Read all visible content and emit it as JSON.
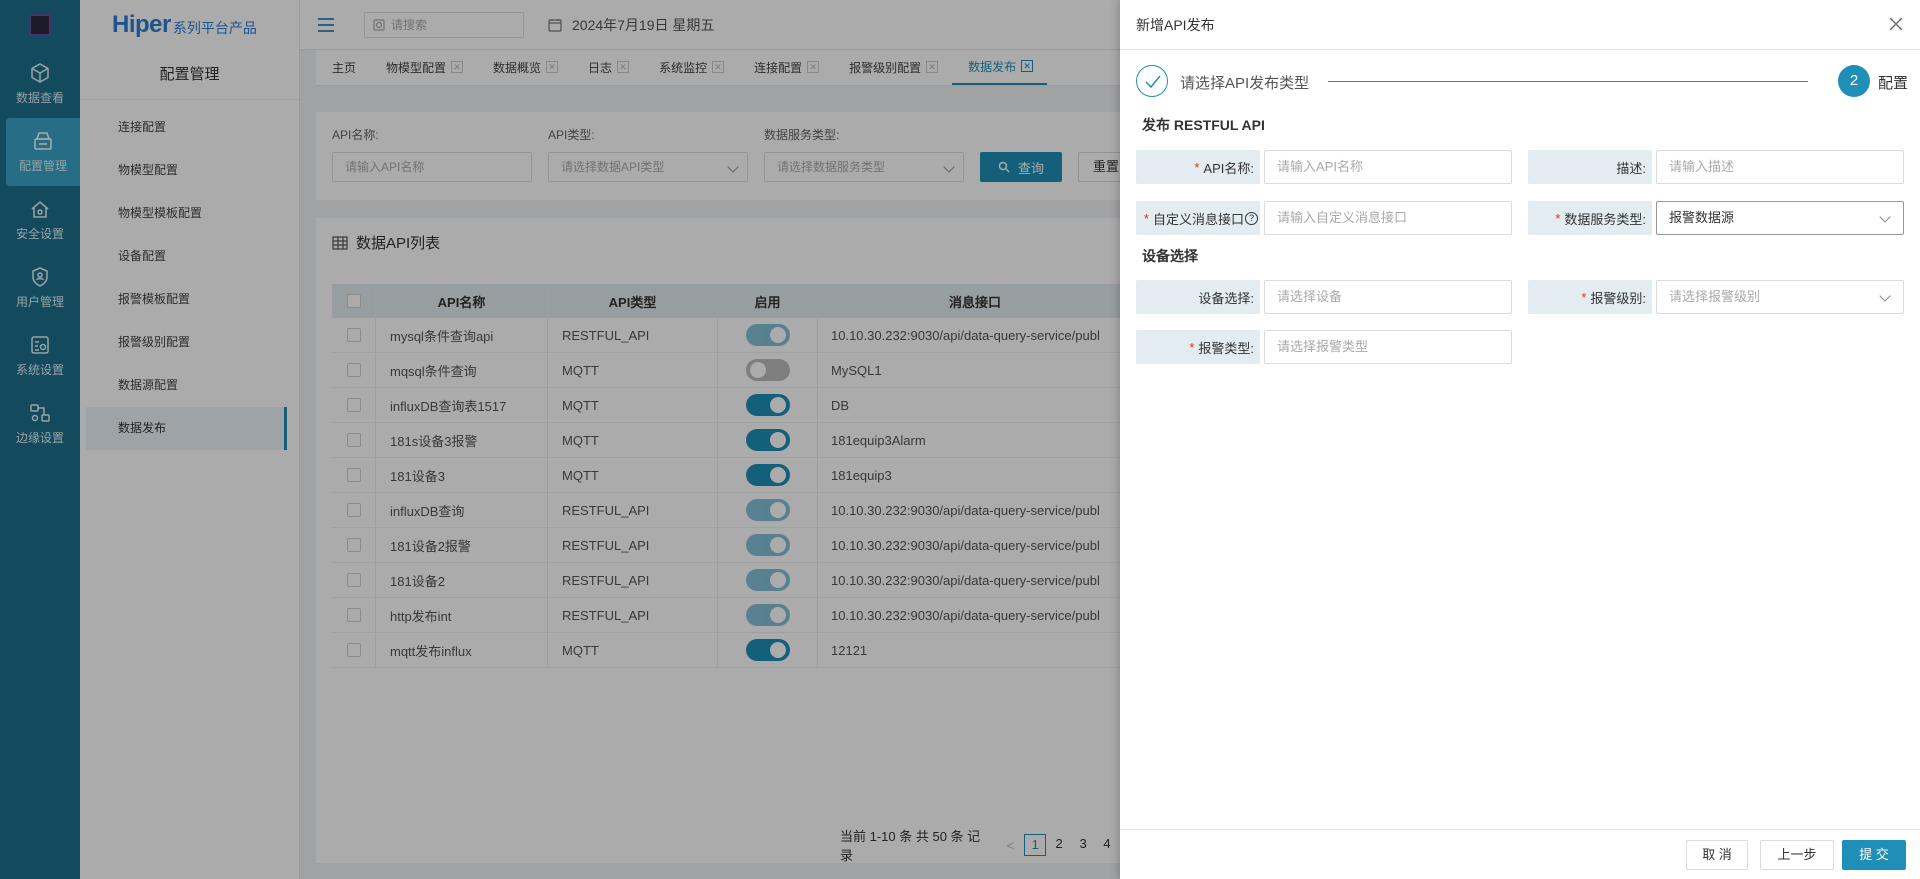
{
  "rail": {
    "items": [
      {
        "label": "数据查看",
        "icon": "cube-icon"
      },
      {
        "label": "配置管理",
        "icon": "config-icon",
        "active": true
      },
      {
        "label": "安全设置",
        "icon": "security-home-icon"
      },
      {
        "label": "用户管理",
        "icon": "shield-user-icon"
      },
      {
        "label": "系统设置",
        "icon": "system-settings-icon"
      },
      {
        "label": "边缘设置",
        "icon": "edge-settings-icon"
      }
    ]
  },
  "brand": {
    "main": "Hiper",
    "sub": "系列平台产品"
  },
  "subnav": {
    "title": "配置管理",
    "items": [
      "连接配置",
      "物模型配置",
      "物模型模板配置",
      "设备配置",
      "报警模板配置",
      "报警级别配置",
      "数据源配置",
      "数据发布"
    ],
    "active_index": 7
  },
  "topbar": {
    "search_placeholder": "请搜索",
    "date": "2024年7月19日 星期五"
  },
  "tabs": [
    {
      "label": "主页",
      "closable": false
    },
    {
      "label": "物模型配置",
      "closable": true
    },
    {
      "label": "数据概览",
      "closable": true
    },
    {
      "label": "日志",
      "closable": true
    },
    {
      "label": "系统监控",
      "closable": true
    },
    {
      "label": "连接配置",
      "closable": true
    },
    {
      "label": "报警级别配置",
      "closable": true
    },
    {
      "label": "数据发布",
      "closable": true,
      "active": true
    }
  ],
  "filter": {
    "api_name_label": "API名称:",
    "api_name_placeholder": "请输入API名称",
    "api_type_label": "API类型:",
    "api_type_placeholder": "请选择数据API类型",
    "service_type_label": "数据服务类型:",
    "service_type_placeholder": "请选择数据服务类型",
    "query_label": "查询",
    "reset_label": "重置"
  },
  "table": {
    "title": "数据API列表",
    "columns": [
      "API名称",
      "API类型",
      "启用",
      "消息接口"
    ],
    "rows": [
      {
        "name": "mysql条件查询api",
        "type": "RESTFUL_API",
        "enabled": true,
        "faded": true,
        "endpoint": "10.10.30.232:9030/api/data-query-service/publ"
      },
      {
        "name": "mqsql条件查询",
        "type": "MQTT",
        "enabled": false,
        "faded": false,
        "endpoint": "MySQL1"
      },
      {
        "name": "influxDB查询表1517",
        "type": "MQTT",
        "enabled": true,
        "faded": false,
        "endpoint": "DB"
      },
      {
        "name": "181s设备3报警",
        "type": "MQTT",
        "enabled": true,
        "faded": false,
        "endpoint": "181equip3Alarm"
      },
      {
        "name": "181设备3",
        "type": "MQTT",
        "enabled": true,
        "faded": false,
        "endpoint": "181equip3"
      },
      {
        "name": "influxDB查询",
        "type": "RESTFUL_API",
        "enabled": true,
        "faded": true,
        "endpoint": "10.10.30.232:9030/api/data-query-service/publ"
      },
      {
        "name": "181设备2报警",
        "type": "RESTFUL_API",
        "enabled": true,
        "faded": true,
        "endpoint": "10.10.30.232:9030/api/data-query-service/publ"
      },
      {
        "name": "181设备2",
        "type": "RESTFUL_API",
        "enabled": true,
        "faded": true,
        "endpoint": "10.10.30.232:9030/api/data-query-service/publ"
      },
      {
        "name": "http发布int",
        "type": "RESTFUL_API",
        "enabled": true,
        "faded": true,
        "endpoint": "10.10.30.232:9030/api/data-query-service/publ"
      },
      {
        "name": "mqtt发布influx",
        "type": "MQTT",
        "enabled": true,
        "faded": false,
        "endpoint": "12121"
      }
    ],
    "pager": {
      "summary": "当前 1-10 条 共 50 条 记录",
      "prev": "<",
      "pages": [
        "1",
        "2",
        "3",
        "4"
      ],
      "current": "1"
    }
  },
  "drawer": {
    "title": "新增API发布",
    "steps": [
      {
        "number": "",
        "label": "请选择API发布类型",
        "status": "done"
      },
      {
        "number": "2",
        "label": "配置",
        "status": "active"
      }
    ],
    "section1": "发布 RESTFUL API",
    "section2": "设备选择",
    "fields": {
      "api_name": {
        "label": "API名称:",
        "placeholder": "请输入API名称",
        "required": true
      },
      "desc": {
        "label": "描述:",
        "placeholder": "请输入描述",
        "required": false
      },
      "custom_endpoint": {
        "label": "自定义消息接口",
        "placeholder": "请输入自定义消息接口",
        "required": true
      },
      "service_type": {
        "label": "数据服务类型:",
        "value": "报警数据源",
        "required": true
      },
      "device": {
        "label": "设备选择:",
        "placeholder": "请选择设备",
        "required": false
      },
      "alarm_level": {
        "label": "报警级别:",
        "placeholder": "请选择报警级别",
        "required": true
      },
      "alarm_type": {
        "label": "报警类型:",
        "placeholder": "请选择报警类型",
        "required": true
      }
    },
    "footer": {
      "cancel": "取 消",
      "prev": "上一步",
      "submit": "提 交"
    }
  },
  "colors": {
    "rail_bg": "#1f6f8b",
    "accent": "#1f8fb8",
    "required": "#e0301e",
    "label_bg": "#e2ecf1"
  }
}
